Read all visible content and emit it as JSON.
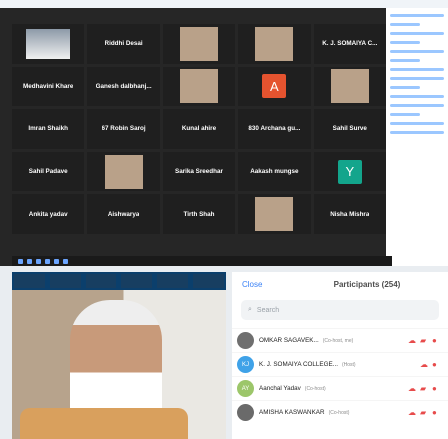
{
  "grid_tiles": [
    {
      "label": "",
      "kind": "video",
      "tag": ""
    },
    {
      "label": "Riddhi Desai",
      "kind": "name",
      "tag": ""
    },
    {
      "label": "",
      "kind": "photo",
      "tag": ""
    },
    {
      "label": "",
      "kind": "photo",
      "tag": ""
    },
    {
      "label": "K. J. SOMAIYA C...",
      "kind": "name",
      "tag": ""
    },
    {
      "label": "Medhavini Khare",
      "kind": "name",
      "tag": ""
    },
    {
      "label": "Ganesh dalbhanj...",
      "kind": "name",
      "tag": ""
    },
    {
      "label": "",
      "kind": "photo",
      "tag": ""
    },
    {
      "label": "A",
      "kind": "letter",
      "color": "#e5532f",
      "tag": ""
    },
    {
      "label": "",
      "kind": "photo",
      "tag": ""
    },
    {
      "label": "Imran Shaikh",
      "kind": "name",
      "tag": ""
    },
    {
      "label": "67 Robin Saroj",
      "kind": "name",
      "tag": ""
    },
    {
      "label": "Kunal ahire",
      "kind": "name",
      "tag": ""
    },
    {
      "label": "830 Archana gu...",
      "kind": "name",
      "tag": ""
    },
    {
      "label": "Sahil Surve",
      "kind": "name",
      "tag": ""
    },
    {
      "label": "Sahil Padave",
      "kind": "name",
      "tag": ""
    },
    {
      "label": "",
      "kind": "photo",
      "tag": ""
    },
    {
      "label": "Sarika Sreedhar",
      "kind": "name",
      "tag": ""
    },
    {
      "label": "Aakash mungse",
      "kind": "name",
      "tag": ""
    },
    {
      "label": "Y",
      "kind": "letter",
      "color": "#13a58c",
      "tag": ""
    },
    {
      "label": "Ankita yadav",
      "kind": "name",
      "tag": ""
    },
    {
      "label": "Aishwarya",
      "kind": "name",
      "tag": ""
    },
    {
      "label": "Tirth Shah",
      "kind": "name",
      "tag": ""
    },
    {
      "label": "",
      "kind": "photo",
      "tag": ""
    },
    {
      "label": "Nisha Mishra",
      "kind": "name",
      "tag": ""
    }
  ],
  "participants_panel": {
    "close": "Close",
    "title": "Participants (254)",
    "search_placeholder": "Search",
    "rows": [
      {
        "name": "OMKAR SAGAVEK...",
        "role": "(Co-host, me)",
        "avatar": "",
        "avatar_color": "#6f6f6f"
      },
      {
        "name": "K. J. SOMAIYA COLLEGE...",
        "role": "(Host)",
        "avatar": "KJ",
        "avatar_color": "#3fa2e8"
      },
      {
        "name": "Aanchal Yadav",
        "role": "(Co-host)",
        "avatar": "AY",
        "avatar_color": "#9cc66a"
      },
      {
        "name": "AMISHA KASWANKAR",
        "role": "(Co-host)",
        "avatar": "",
        "avatar_color": "#6a6a6a"
      }
    ]
  },
  "strip_labels": [
    "",
    "",
    "",
    "",
    "",
    "",
    ""
  ]
}
